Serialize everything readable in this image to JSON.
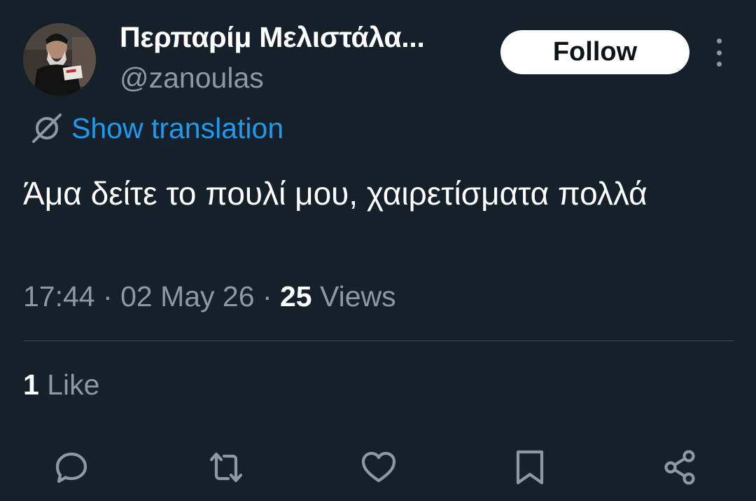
{
  "tweet": {
    "author": {
      "display_name": "Περπαρίμ Μελιστάλα...",
      "handle": "@zanoulas"
    },
    "follow_label": "Follow",
    "translation_label": "Show translation",
    "text": "Άμα δείτε το πουλί μου, χαιρετίσματα πολλά",
    "time": "17:44",
    "separator": "·",
    "date": "02 May 26",
    "views_count": "25",
    "views_label": "Views",
    "likes_count": "1",
    "likes_label": "Like"
  },
  "colors": {
    "background": "#15202b",
    "text_primary": "#ffffff",
    "text_secondary": "#8b98a5",
    "accent": "#1d9bf0",
    "divider": "#38444d"
  },
  "icons": {
    "more": "more-vertical-icon",
    "translate": "translate-icon",
    "reply": "reply-icon",
    "retweet": "retweet-icon",
    "like": "heart-icon",
    "bookmark": "bookmark-icon",
    "share": "share-icon"
  }
}
